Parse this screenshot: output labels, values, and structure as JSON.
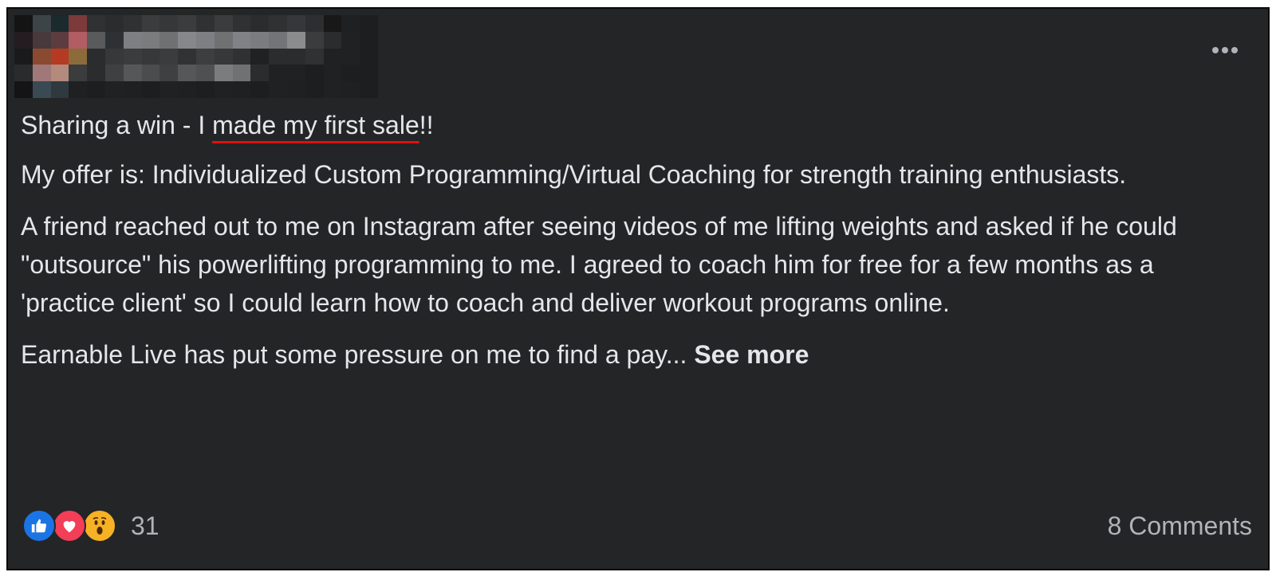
{
  "post": {
    "author_colors": [
      "#141414",
      "#3c4448",
      "#1b2a2d",
      "#7c3a3a",
      "#2f3133",
      "#2a2c2e",
      "#2f3133",
      "#3a3c3e",
      "#353739",
      "#3a3c3e",
      "#2f3133",
      "#3a3c3e",
      "#2f3133",
      "#2a2c2e",
      "#2f3133",
      "#35373a",
      "#2c2e30",
      "#181818",
      "#1f2022",
      "#1d1e20",
      "#241c20",
      "#47393c",
      "#5c3c3f",
      "#b25c63",
      "#585a5c",
      "#2e3133",
      "#7d7f82",
      "#7a7c7e",
      "#6f7173",
      "#85878a",
      "#7d7f82",
      "#6f7173",
      "#808285",
      "#7a7c7e",
      "#727477",
      "#8a8c8e",
      "#3a3c3e",
      "#2a2c2e",
      "#202123",
      "#1d1e20",
      "#1a1a1c",
      "#8a4a30",
      "#b53a22",
      "#8c6a3a",
      "#2a2c2e",
      "#36383a",
      "#3a3c3e",
      "#36383a",
      "#3a3c3e",
      "#303234",
      "#3c3e40",
      "#36383a",
      "#2f3133",
      "#202123",
      "#2a2c2e",
      "#2a2c2e",
      "#2f3133",
      "#202123",
      "#202123",
      "#1d1e20",
      "#2a2b2d",
      "#a0787a",
      "#b48a7c",
      "#3a3c3e",
      "#2a2c2e",
      "#3e4042",
      "#555759",
      "#4a4c4e",
      "#3e4042",
      "#555759",
      "#4e5052",
      "#7a7c7e",
      "#6f7173",
      "#2a2c2e",
      "#202123",
      "#202123",
      "#1d1e20",
      "#202123",
      "#1d1e20",
      "#1d1e20",
      "#141416",
      "#3a4a52",
      "#2e3a40",
      "#1f2022",
      "#1d1e20",
      "#202123",
      "#1f2022",
      "#1d1e20",
      "#202123",
      "#1f2022",
      "#1d1e20",
      "#202123",
      "#1f2022",
      "#1d1e20",
      "#202123",
      "#1f2022",
      "#1d1e20",
      "#202123",
      "#1f2022",
      "#1d1e20"
    ],
    "more_icon": "ellipsis-horizontal-icon",
    "title_prefix": "Sharing a win - I ",
    "title_highlight": "made my first sale",
    "title_suffix": "!!",
    "paragraphs": [
      "My offer is: Individualized Custom Programming/Virtual Coaching for strength training enthusiasts.",
      "A friend reached out to me on Instagram after seeing videos of me lifting weights and asked if he could \"outsource\" his powerlifting programming to me. I agreed to coach him for free for a few months as a 'practice client' so I could learn how to coach and deliver workout programs online."
    ],
    "truncated_text": "Earnable Live has put some pressure on me to find a pay... ",
    "see_more_label": "See more",
    "highlight_color": "#e01010"
  },
  "footer": {
    "reactions": [
      "like-icon",
      "love-icon",
      "wow-icon"
    ],
    "reaction_count": "31",
    "comments_label": "8 Comments"
  }
}
